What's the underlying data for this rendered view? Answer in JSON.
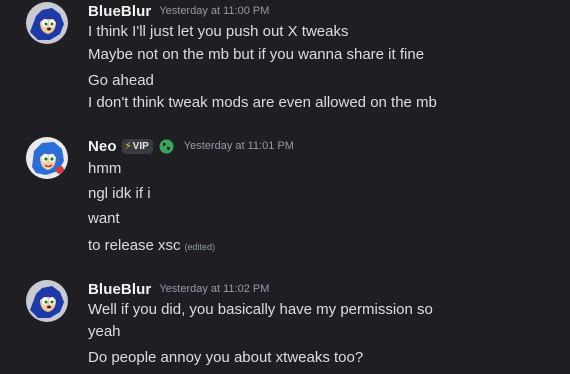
{
  "messages": [
    {
      "username": "BlueBlur",
      "timestamp": "Yesterday at 11:00 PM",
      "avatar_icon": "sonic-avatar-icon",
      "lines": [
        "I think I'll just let you push out X tweaks",
        "Maybe not on the mb but if you wanna share it fine",
        "Go ahead",
        "I don't think tweak mods are even allowed on the mb"
      ]
    },
    {
      "username": "Neo",
      "badge": "VIP",
      "badge_icon": "lightning-icon",
      "status_icon": "globe-icon",
      "timestamp": "Yesterday at 11:01 PM",
      "avatar_icon": "sonic-avatar-icon",
      "lines": [
        "hmm",
        "ngl idk if i",
        "want",
        "to release xsc"
      ],
      "edited_label": "(edited)"
    },
    {
      "username": "BlueBlur",
      "timestamp": "Yesterday at 11:02 PM",
      "avatar_icon": "sonic-avatar-icon",
      "lines": [
        "Well if you did, you basically have my permission so",
        "yeah",
        "Do people annoy you about xtweaks too?"
      ]
    }
  ],
  "colors": {
    "background": "#1f1f23",
    "username": "#f2f3f5",
    "text": "#dbdee1",
    "timestamp": "#949ba4",
    "badge_bg": "#3a3b40",
    "globe": "#3ba55c"
  }
}
